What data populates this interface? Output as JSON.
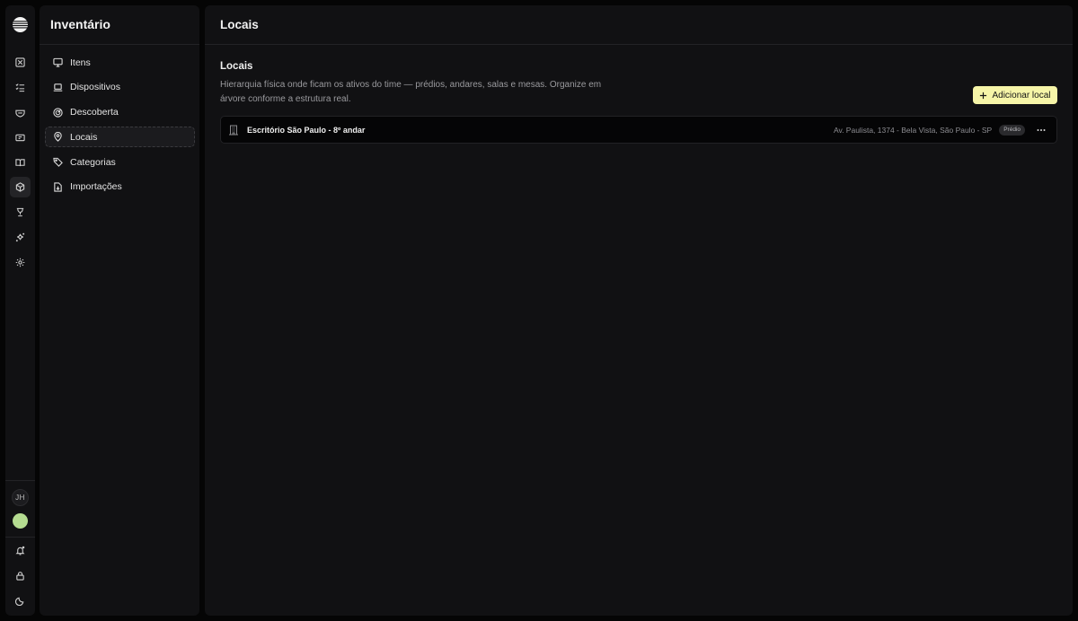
{
  "rail": {
    "icons": [
      "logo-icon",
      "dashboard-icon",
      "checklist-icon",
      "shield-icon",
      "ticket-icon",
      "book-icon",
      "box-icon",
      "trophy-icon",
      "sparkles-icon",
      "gear-icon"
    ],
    "active": "box-icon",
    "user_initials": "JH",
    "avatar_color": "#b5dc91",
    "bottom_icons": [
      "bell-icon",
      "lock-icon",
      "moon-icon"
    ]
  },
  "sidebar": {
    "title": "Inventário",
    "items": [
      {
        "label": "Itens",
        "icon": "monitor-icon",
        "active": false
      },
      {
        "label": "Dispositivos",
        "icon": "laptop-icon",
        "active": false
      },
      {
        "label": "Descoberta",
        "icon": "radar-icon",
        "active": false
      },
      {
        "label": "Locais",
        "icon": "map-pin-icon",
        "active": true
      },
      {
        "label": "Categorias",
        "icon": "tag-icon",
        "active": false
      },
      {
        "label": "Importações",
        "icon": "file-import-icon",
        "active": false
      }
    ]
  },
  "main": {
    "header_title": "Locais",
    "section_title": "Locais",
    "section_description": "Hierarquia física onde ficam os ativos do time — prédios, andares, salas e mesas. Organize em árvore conforme a estrutura real.",
    "add_button_label": "Adicionar local",
    "locations": [
      {
        "name": "Escritório São Paulo - 8º andar",
        "address": "Av. Paulista, 1374 - Bela Vista, São Paulo - SP",
        "type": "Prédio",
        "icon": "building-icon"
      }
    ]
  },
  "colors": {
    "background": "#050505",
    "panel": "#111113",
    "accent_button": "#f6f5a8"
  }
}
